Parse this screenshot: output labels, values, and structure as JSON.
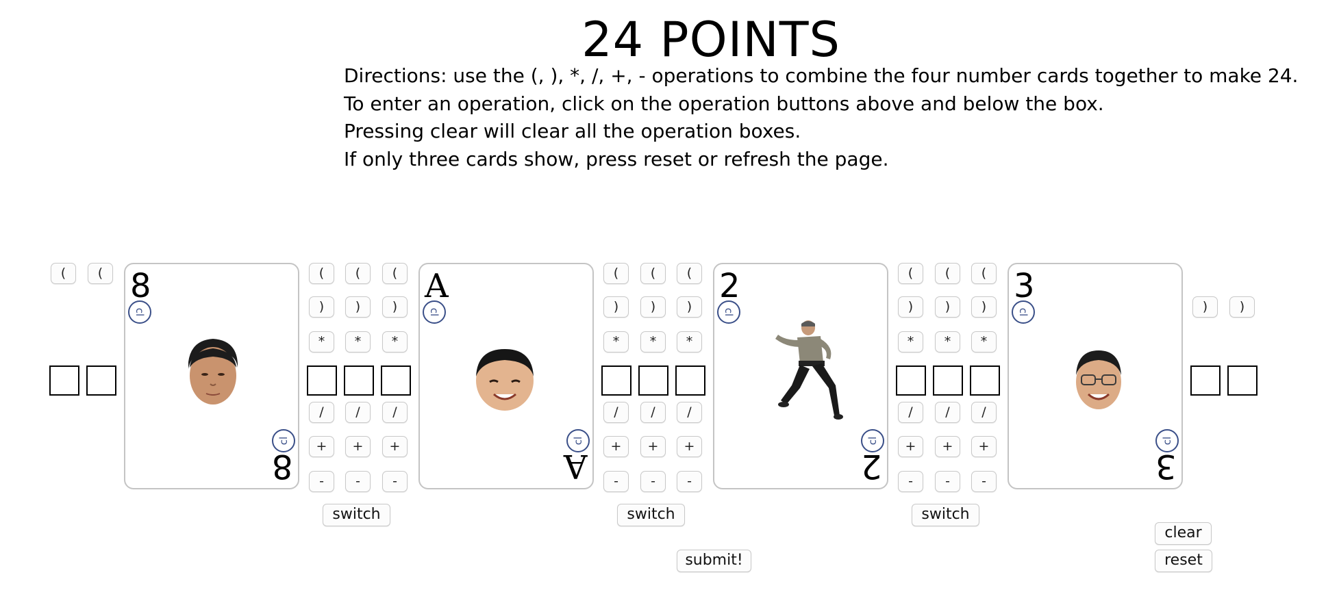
{
  "title": "24 POINTS",
  "directions": [
    "Directions: use the (, ), *, /, +, - operations to combine the four number cards together to make 24.",
    "To enter an operation, click on the operation buttons above and below the box.",
    "Pressing clear will clear all the operation boxes.",
    "If only three cards show, press reset or refresh the page."
  ],
  "operators": {
    "open_paren": "(",
    "close_paren": ")",
    "multiply": "*",
    "divide": "/",
    "add": "+",
    "subtract": "-"
  },
  "cards": [
    {
      "rank": "8",
      "logo": "cl"
    },
    {
      "rank": "A",
      "logo": "cl"
    },
    {
      "rank": "2",
      "logo": "cl"
    },
    {
      "rank": "3",
      "logo": "cl"
    }
  ],
  "buttons": {
    "switch": "switch",
    "submit": "submit!",
    "clear": "clear",
    "reset": "reset"
  },
  "colors": {
    "logo": "#3a4f88",
    "card_border": "#c4c4c4"
  }
}
